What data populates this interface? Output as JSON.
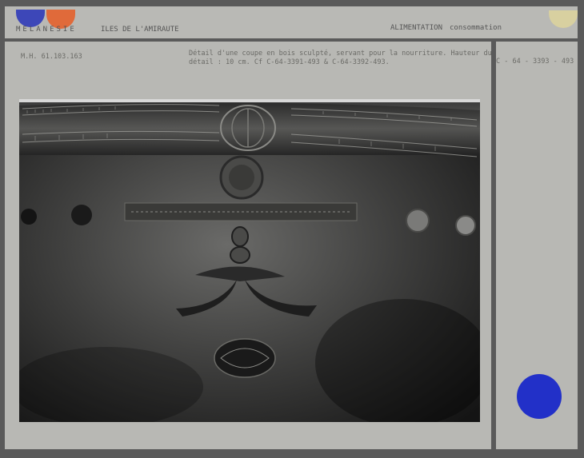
{
  "header": {
    "region": "MELANESIE",
    "place": "ILES DE L'AMIRAUTE",
    "category": "ALIMENTATION",
    "subcategory": "consommation"
  },
  "record": {
    "inventory": "M.H. 61.103.163",
    "description_line1": "Détail d'une coupe en bois sculpté, servant pour la nourriture. Hauteur du",
    "description_line2": "détail : 10 cm. Cf C-64-3391-493 & C-64-3392-493.",
    "photo_ref": "C - 64 - 3393 - 493"
  },
  "colors": {
    "dot_blue": "#3d47b8",
    "dot_orange": "#e06a3a",
    "dot_gold": "#d8d0a0",
    "dot_blue_big": "#2230c8"
  }
}
